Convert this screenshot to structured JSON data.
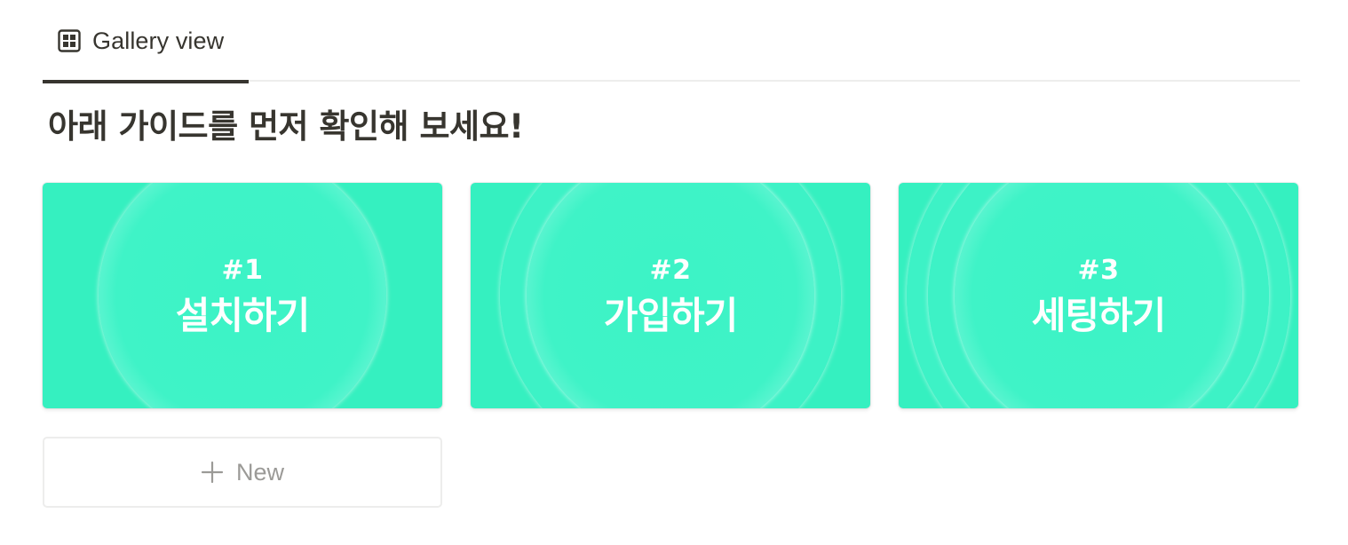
{
  "tabs": [
    {
      "label": "Gallery view",
      "icon": "gallery-grid-icon",
      "active": true
    }
  ],
  "heading": "아래 가이드를 먼저 확인해 보세요!",
  "cards": [
    {
      "number": "#1",
      "title": "설치하기"
    },
    {
      "number": "#2",
      "title": "가입하기"
    },
    {
      "number": "#3",
      "title": "세팅하기"
    }
  ],
  "new_button": {
    "label": "New",
    "icon": "plus-icon"
  },
  "colors": {
    "card_background": "#35f0c0",
    "text_primary": "#37352f",
    "text_muted": "#9b9a97",
    "border": "#ededec"
  }
}
